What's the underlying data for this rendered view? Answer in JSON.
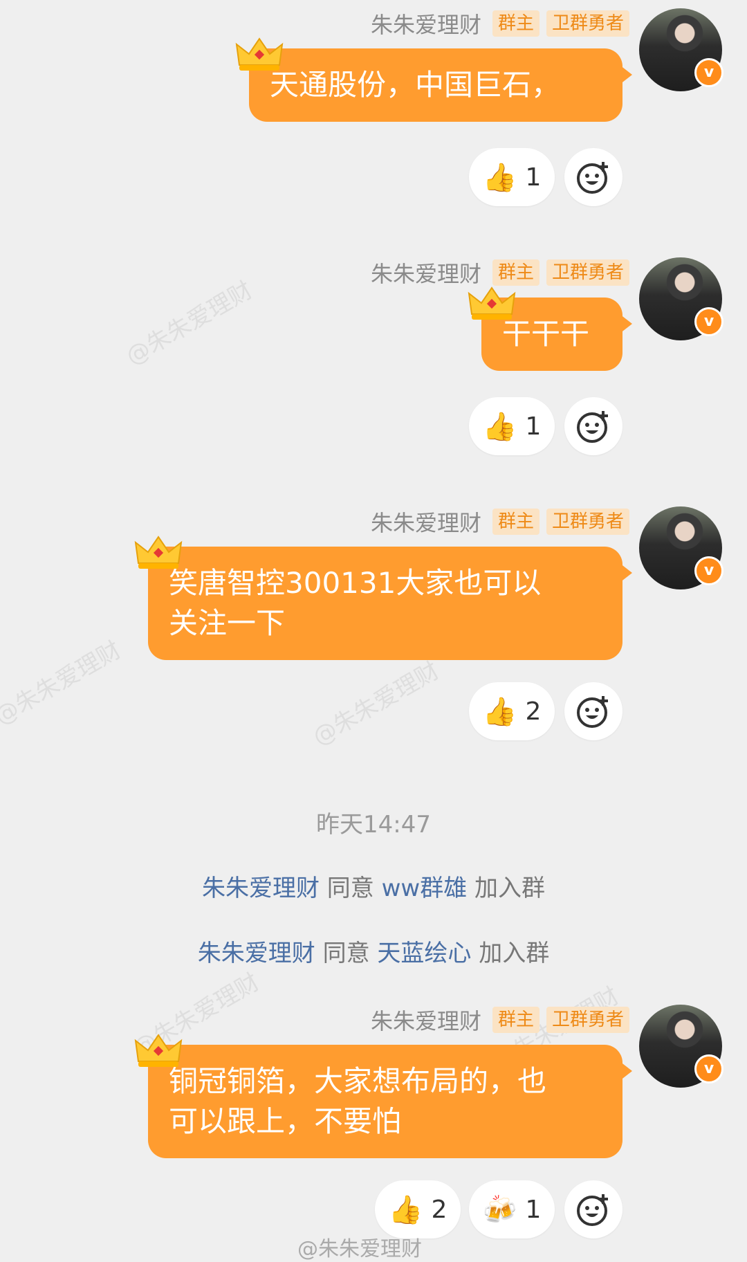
{
  "messages": [
    {
      "sender": "朱朱爱理财",
      "tags": [
        "群主",
        "卫群勇者"
      ],
      "lines": [
        "天通股份，中国巨石，"
      ],
      "reactions": [
        {
          "icon": "thumbs-up",
          "count": "1"
        }
      ]
    },
    {
      "sender": "朱朱爱理财",
      "tags": [
        "群主",
        "卫群勇者"
      ],
      "lines": [
        "干干干"
      ],
      "reactions": [
        {
          "icon": "thumbs-up",
          "count": "1"
        }
      ]
    },
    {
      "sender": "朱朱爱理财",
      "tags": [
        "群主",
        "卫群勇者"
      ],
      "lines": [
        "笑唐智控300131大家也可以",
        "关注一下"
      ],
      "reactions": [
        {
          "icon": "thumbs-up",
          "count": "2"
        }
      ]
    },
    {
      "sender": "朱朱爱理财",
      "tags": [
        "群主",
        "卫群勇者"
      ],
      "lines": [
        "铜冠铜箔，大家想布局的，也",
        "可以跟上，不要怕"
      ],
      "reactions": [
        {
          "icon": "thumbs-up",
          "count": "2"
        },
        {
          "icon": "beer-mugs",
          "count": "1"
        }
      ]
    }
  ],
  "system": {
    "time": "昨天14:47",
    "joins": [
      {
        "approver": "朱朱爱理财",
        "verb": "同意",
        "user": "ww群雄",
        "suffix": "加入群"
      },
      {
        "approver": "朱朱爱理财",
        "verb": "同意",
        "user": "天蓝绘心",
        "suffix": "加入群"
      }
    ]
  },
  "watermark": "@朱朱爱理财",
  "colors": {
    "bubble": "#ff9c2f",
    "tag_text": "#ee8a17",
    "link_blue": "#4a6fa5"
  }
}
